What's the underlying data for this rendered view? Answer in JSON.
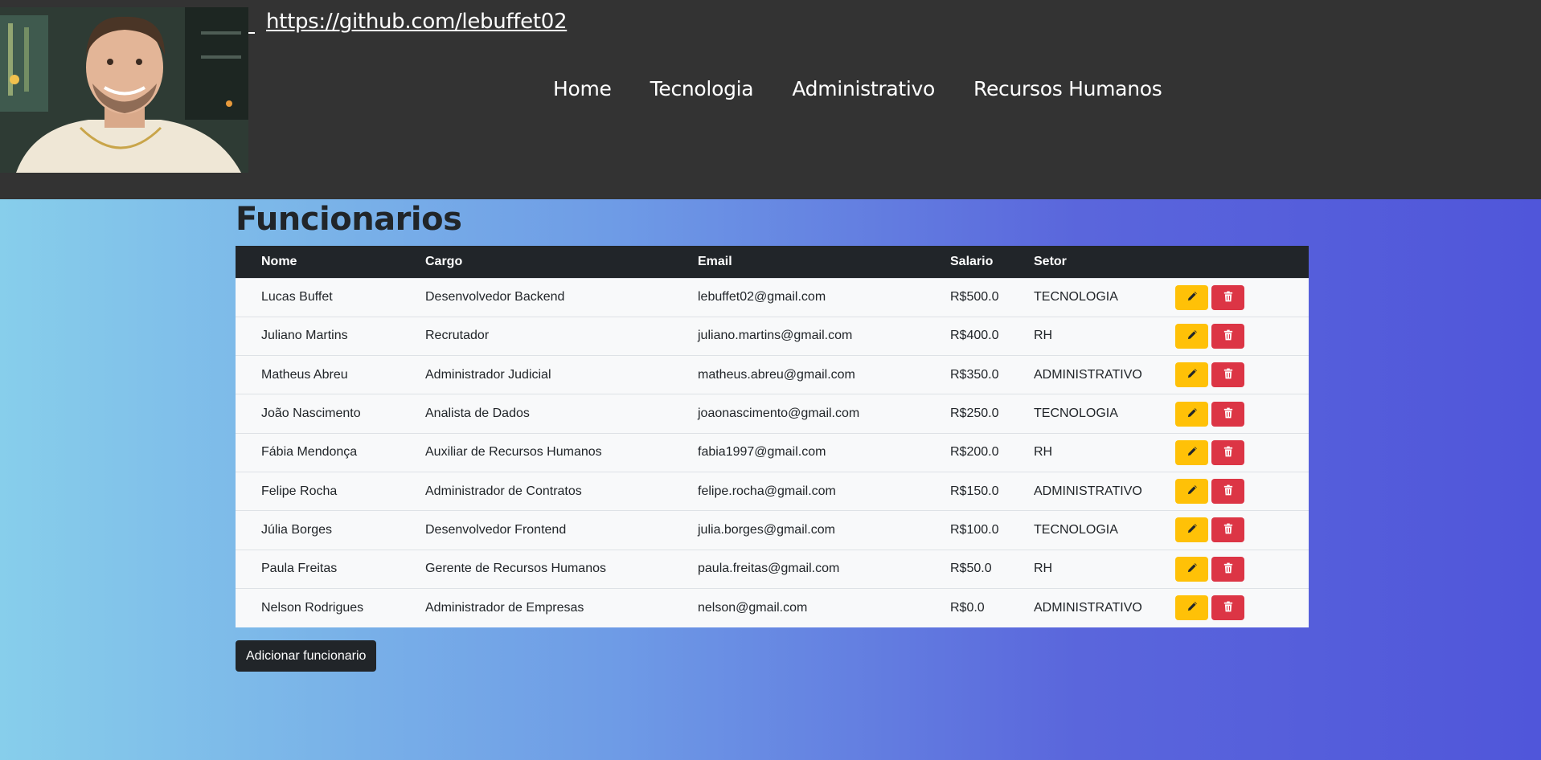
{
  "header": {
    "github_link": "https://github.com/lebuffet02",
    "nav": [
      "Home",
      "Tecnologia",
      "Administrativo",
      "Recursos Humanos"
    ]
  },
  "page": {
    "title": "Funcionarios",
    "add_button": "Adicionar funcionario"
  },
  "table": {
    "headers": [
      "Nome",
      "Cargo",
      "Email",
      "Salario",
      "Setor"
    ],
    "rows": [
      {
        "nome": "Lucas Buffet",
        "cargo": "Desenvolvedor Backend",
        "email": "lebuffet02@gmail.com",
        "salario": "R$500.0",
        "setor": "TECNOLOGIA"
      },
      {
        "nome": "Juliano Martins",
        "cargo": "Recrutador",
        "email": "juliano.martins@gmail.com",
        "salario": "R$400.0",
        "setor": "RH"
      },
      {
        "nome": "Matheus Abreu",
        "cargo": "Administrador Judicial",
        "email": "matheus.abreu@gmail.com",
        "salario": "R$350.0",
        "setor": "ADMINISTRATIVO"
      },
      {
        "nome": "João Nascimento",
        "cargo": "Analista de Dados",
        "email": "joaonascimento@gmail.com",
        "salario": "R$250.0",
        "setor": "TECNOLOGIA"
      },
      {
        "nome": "Fábia Mendonça",
        "cargo": "Auxiliar de Recursos Humanos",
        "email": "fabia1997@gmail.com",
        "salario": "R$200.0",
        "setor": "RH"
      },
      {
        "nome": "Felipe Rocha",
        "cargo": "Administrador de Contratos",
        "email": "felipe.rocha@gmail.com",
        "salario": "R$150.0",
        "setor": "ADMINISTRATIVO"
      },
      {
        "nome": "Júlia Borges",
        "cargo": "Desenvolvedor Frontend",
        "email": "julia.borges@gmail.com",
        "salario": "R$100.0",
        "setor": "TECNOLOGIA"
      },
      {
        "nome": "Paula Freitas",
        "cargo": "Gerente de Recursos Humanos",
        "email": "paula.freitas@gmail.com",
        "salario": "R$50.0",
        "setor": "RH"
      },
      {
        "nome": "Nelson Rodrigues",
        "cargo": "Administrador de Empresas",
        "email": "nelson@gmail.com",
        "salario": "R$0.0",
        "setor": "ADMINISTRATIVO"
      }
    ]
  },
  "icons": {
    "edit": "pencil-icon",
    "delete": "trash-icon"
  },
  "colors": {
    "topbar": "#333333",
    "edit_button": "#ffc107",
    "delete_button": "#dc3545",
    "table_header": "#212529"
  }
}
